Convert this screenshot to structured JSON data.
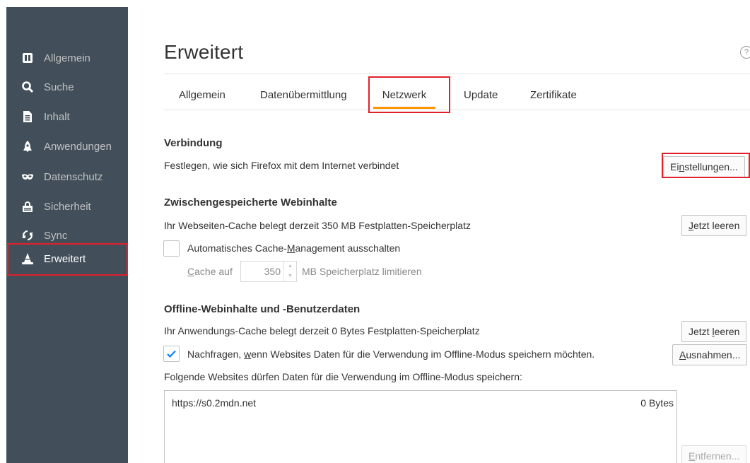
{
  "sidebar": {
    "items": [
      {
        "label": "Allgemein",
        "icon": "general-icon"
      },
      {
        "label": "Suche",
        "icon": "search-icon"
      },
      {
        "label": "Inhalt",
        "icon": "document-icon"
      },
      {
        "label": "Anwendungen",
        "icon": "rocket-icon"
      },
      {
        "label": "Datenschutz",
        "icon": "mask-icon"
      },
      {
        "label": "Sicherheit",
        "icon": "lock-icon"
      },
      {
        "label": "Sync",
        "icon": "sync-icon"
      },
      {
        "label": "Erweitert",
        "icon": "wizard-hat-icon"
      }
    ],
    "active": "Erweitert"
  },
  "page": {
    "title": "Erweitert",
    "help": "?"
  },
  "tabs": [
    {
      "label": "Allgemein"
    },
    {
      "label": "Datenübermittlung"
    },
    {
      "label": "Netzwerk"
    },
    {
      "label": "Update"
    },
    {
      "label": "Zertifikate"
    }
  ],
  "selected_tab": "Netzwerk",
  "connection": {
    "heading": "Verbindung",
    "description": "Festlegen, wie sich Firefox mit dem Internet verbindet",
    "button_pre": "Ei",
    "button_accel": "n",
    "button_post": "stellungen..."
  },
  "cache": {
    "heading": "Zwischengespeicherte Webinhalte",
    "description": "Ihr Webseiten-Cache belegt derzeit 350 MB Festplatten-Speicherplatz",
    "clear_accel": "J",
    "clear_post": "etzt leeren",
    "override_pre": "Automatisches Cache-",
    "override_accel": "M",
    "override_post": "anagement ausschalten",
    "override_checked": false,
    "limit_accel": "C",
    "limit_pre": "ache auf",
    "limit_value": "350",
    "limit_post": "MB Speicherplatz limitieren"
  },
  "offline": {
    "heading": "Offline-Webinhalte und -Benutzerdaten",
    "description": "Ihr Anwendungs-Cache belegt derzeit 0 Bytes Festplatten-Speicherplatz",
    "clear_pre": "Jetzt ",
    "clear_accel": "l",
    "clear_post": "eeren",
    "ask_pre": "Nachfragen, ",
    "ask_accel": "w",
    "ask_post": "enn Websites Daten für die Verwendung im Offline-Modus speichern möchten.",
    "ask_checked": true,
    "exceptions_accel": "A",
    "exceptions_post": "usnahmen...",
    "list_label": "Folgende Websites dürfen Daten für die Verwendung im Offline-Modus speichern:",
    "sites": [
      {
        "site": "https://s0.2mdn.net",
        "size": "0 Bytes"
      }
    ],
    "remove_accel": "E",
    "remove_post": "ntfernen..."
  },
  "colors": {
    "sidebar_bg": "#424f5a",
    "tab_underline": "#ff9500",
    "highlight_box": "#e0202a",
    "checkbox_check": "#0a84ff"
  }
}
